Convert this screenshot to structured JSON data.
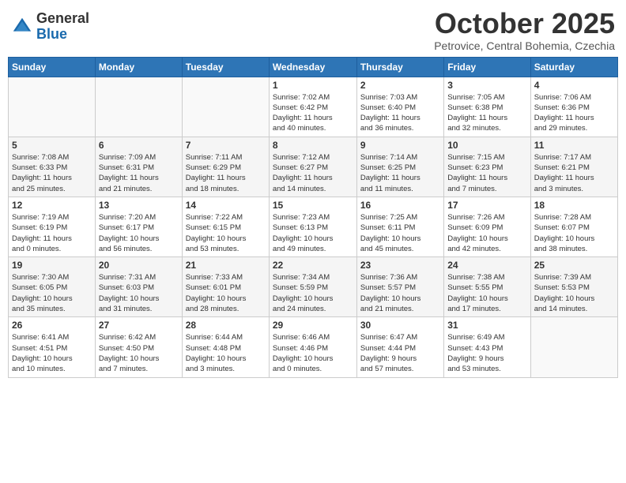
{
  "header": {
    "logo_general": "General",
    "logo_blue": "Blue",
    "month_title": "October 2025",
    "location": "Petrovice, Central Bohemia, Czechia"
  },
  "days_of_week": [
    "Sunday",
    "Monday",
    "Tuesday",
    "Wednesday",
    "Thursday",
    "Friday",
    "Saturday"
  ],
  "weeks": [
    [
      {
        "day": "",
        "info": ""
      },
      {
        "day": "",
        "info": ""
      },
      {
        "day": "",
        "info": ""
      },
      {
        "day": "1",
        "info": "Sunrise: 7:02 AM\nSunset: 6:42 PM\nDaylight: 11 hours\nand 40 minutes."
      },
      {
        "day": "2",
        "info": "Sunrise: 7:03 AM\nSunset: 6:40 PM\nDaylight: 11 hours\nand 36 minutes."
      },
      {
        "day": "3",
        "info": "Sunrise: 7:05 AM\nSunset: 6:38 PM\nDaylight: 11 hours\nand 32 minutes."
      },
      {
        "day": "4",
        "info": "Sunrise: 7:06 AM\nSunset: 6:36 PM\nDaylight: 11 hours\nand 29 minutes."
      }
    ],
    [
      {
        "day": "5",
        "info": "Sunrise: 7:08 AM\nSunset: 6:33 PM\nDaylight: 11 hours\nand 25 minutes."
      },
      {
        "day": "6",
        "info": "Sunrise: 7:09 AM\nSunset: 6:31 PM\nDaylight: 11 hours\nand 21 minutes."
      },
      {
        "day": "7",
        "info": "Sunrise: 7:11 AM\nSunset: 6:29 PM\nDaylight: 11 hours\nand 18 minutes."
      },
      {
        "day": "8",
        "info": "Sunrise: 7:12 AM\nSunset: 6:27 PM\nDaylight: 11 hours\nand 14 minutes."
      },
      {
        "day": "9",
        "info": "Sunrise: 7:14 AM\nSunset: 6:25 PM\nDaylight: 11 hours\nand 11 minutes."
      },
      {
        "day": "10",
        "info": "Sunrise: 7:15 AM\nSunset: 6:23 PM\nDaylight: 11 hours\nand 7 minutes."
      },
      {
        "day": "11",
        "info": "Sunrise: 7:17 AM\nSunset: 6:21 PM\nDaylight: 11 hours\nand 3 minutes."
      }
    ],
    [
      {
        "day": "12",
        "info": "Sunrise: 7:19 AM\nSunset: 6:19 PM\nDaylight: 11 hours\nand 0 minutes."
      },
      {
        "day": "13",
        "info": "Sunrise: 7:20 AM\nSunset: 6:17 PM\nDaylight: 10 hours\nand 56 minutes."
      },
      {
        "day": "14",
        "info": "Sunrise: 7:22 AM\nSunset: 6:15 PM\nDaylight: 10 hours\nand 53 minutes."
      },
      {
        "day": "15",
        "info": "Sunrise: 7:23 AM\nSunset: 6:13 PM\nDaylight: 10 hours\nand 49 minutes."
      },
      {
        "day": "16",
        "info": "Sunrise: 7:25 AM\nSunset: 6:11 PM\nDaylight: 10 hours\nand 45 minutes."
      },
      {
        "day": "17",
        "info": "Sunrise: 7:26 AM\nSunset: 6:09 PM\nDaylight: 10 hours\nand 42 minutes."
      },
      {
        "day": "18",
        "info": "Sunrise: 7:28 AM\nSunset: 6:07 PM\nDaylight: 10 hours\nand 38 minutes."
      }
    ],
    [
      {
        "day": "19",
        "info": "Sunrise: 7:30 AM\nSunset: 6:05 PM\nDaylight: 10 hours\nand 35 minutes."
      },
      {
        "day": "20",
        "info": "Sunrise: 7:31 AM\nSunset: 6:03 PM\nDaylight: 10 hours\nand 31 minutes."
      },
      {
        "day": "21",
        "info": "Sunrise: 7:33 AM\nSunset: 6:01 PM\nDaylight: 10 hours\nand 28 minutes."
      },
      {
        "day": "22",
        "info": "Sunrise: 7:34 AM\nSunset: 5:59 PM\nDaylight: 10 hours\nand 24 minutes."
      },
      {
        "day": "23",
        "info": "Sunrise: 7:36 AM\nSunset: 5:57 PM\nDaylight: 10 hours\nand 21 minutes."
      },
      {
        "day": "24",
        "info": "Sunrise: 7:38 AM\nSunset: 5:55 PM\nDaylight: 10 hours\nand 17 minutes."
      },
      {
        "day": "25",
        "info": "Sunrise: 7:39 AM\nSunset: 5:53 PM\nDaylight: 10 hours\nand 14 minutes."
      }
    ],
    [
      {
        "day": "26",
        "info": "Sunrise: 6:41 AM\nSunset: 4:51 PM\nDaylight: 10 hours\nand 10 minutes."
      },
      {
        "day": "27",
        "info": "Sunrise: 6:42 AM\nSunset: 4:50 PM\nDaylight: 10 hours\nand 7 minutes."
      },
      {
        "day": "28",
        "info": "Sunrise: 6:44 AM\nSunset: 4:48 PM\nDaylight: 10 hours\nand 3 minutes."
      },
      {
        "day": "29",
        "info": "Sunrise: 6:46 AM\nSunset: 4:46 PM\nDaylight: 10 hours\nand 0 minutes."
      },
      {
        "day": "30",
        "info": "Sunrise: 6:47 AM\nSunset: 4:44 PM\nDaylight: 9 hours\nand 57 minutes."
      },
      {
        "day": "31",
        "info": "Sunrise: 6:49 AM\nSunset: 4:43 PM\nDaylight: 9 hours\nand 53 minutes."
      },
      {
        "day": "",
        "info": ""
      }
    ]
  ]
}
